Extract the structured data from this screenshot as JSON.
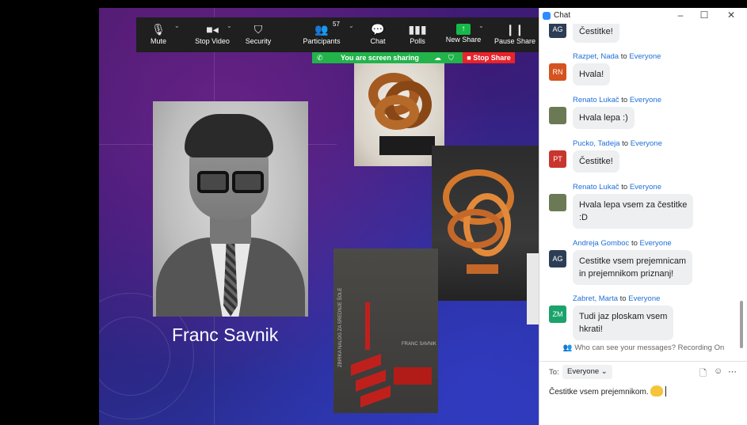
{
  "toolbar": {
    "mute_label": "Mute",
    "stop_video_label": "Stop Video",
    "security_label": "Security",
    "participants_label": "Participants",
    "participants_count": "57",
    "chat_label": "Chat",
    "polls_label": "Polls",
    "new_share_label": "New Share",
    "pause_share_label": "Pause Share"
  },
  "sharing_bar": {
    "status_text": "You are screen sharing",
    "stop_label": "Stop Share"
  },
  "slide": {
    "caption": "Franc Savnik",
    "book_spine": "ZBIRKA NALOG ZA SREDNJE ŠOLE",
    "book_author": "FRANC SAVNIK"
  },
  "chat": {
    "window_title": "Chat",
    "to_everyone": "to",
    "everyone": "Everyone",
    "messages": [
      {
        "initials": "AG",
        "avatar_color": "#2c3e55",
        "sender": "",
        "text": "Čestitke!"
      },
      {
        "initials": "RN",
        "avatar_color": "#d4531e",
        "sender": "Razpet, Nada",
        "text": "Hvala!"
      },
      {
        "initials": "",
        "avatar_color": "#6b7a55",
        "sender": "Renato Lukač",
        "text": "Hvala lepa :)"
      },
      {
        "initials": "PT",
        "avatar_color": "#c8352e",
        "sender": "Pucko, Tadeja",
        "text": "Čestitke!"
      },
      {
        "initials": "",
        "avatar_color": "#6b7a55",
        "sender": "Renato Lukač",
        "text_line1": "Hvala lepa vsem za čestitke",
        "text_line2": ":D"
      },
      {
        "initials": "AG",
        "avatar_color": "#2c3e55",
        "sender": "Andreja Gomboc",
        "text_line1": "Cestitke vsem prejemnicam",
        "text_line2": "in prejemnikom priznanj!"
      },
      {
        "initials": "ZM",
        "avatar_color": "#1aa36a",
        "sender": "Zabret, Marta",
        "text_line1": "Tudi jaz ploskam vsem",
        "text_line2": "hkrati!"
      }
    ],
    "notice": "Who can see your messages? Recording On",
    "to_label": "To:",
    "recipient": "Everyone",
    "draft": "Čestitke vsem prejemnikom."
  },
  "colors": {
    "toolbar_bg": "#1f1f1f",
    "share_green": "#22b34b",
    "stop_red": "#e8232a",
    "link_blue": "#1f6fd8"
  }
}
